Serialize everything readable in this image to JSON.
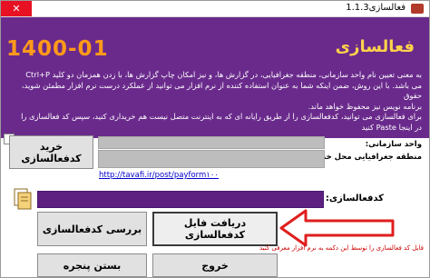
{
  "window": {
    "title": "فعالسازی1.1.3",
    "close_glyph": "✕"
  },
  "banner": {
    "date": "1400-01",
    "heading": "فعالسازی",
    "paragraph": [
      "به معنی تعیین نام واحد سازمانی، منطقه جغرافیایی، در گزارش ها، و نیز امکان چاپ گزارش ها، با زدن همزمان دو کلید Ctrl+P",
      "می باشد. با این روش، ضمن اینکه شما به عنوان استفاده کننده از نرم افزار می توانید از عملکرد درست نرم افزار مطمئن شوید، حقوق",
      "برنامه نویس نیز محفوظ خواهد ماند.",
      "برای فعالسازی می توانید، کدفعالسازی را از طریق رایانه ای که به اینترنت متصل نیست هم خریداری کنید، سپس کد فعالسازی را",
      "در اینجا Paste کنید"
    ]
  },
  "form": {
    "org_unit_label": "واحد سازمانی:",
    "region_label": "منطقه جغرافیایی محل خدمت:",
    "buy_code_button": "خرید کدفعالسازی",
    "link": "http://tavafi.ir/post/payform١٠٠",
    "code_label": "کدفعالسازی:",
    "download_file_button": "دریافت فایل کدفعالسازی",
    "check_code_button": "بررسی کدفعالسازی",
    "exit_button": "خروج",
    "close_window_button": "بستن پنجره",
    "note": "فایل کد فعالسازی را توسط این دکمه به نرم افزار معرفی کنید"
  },
  "colors": {
    "banner": "#6a2a8c",
    "date": "#ff9a1a",
    "heading": "#ffd24a",
    "arrow": "#e01e1e",
    "code_bar": "#5d2080"
  },
  "icons": {
    "app": "app-icon",
    "document": "document-icon",
    "arrow": "red-arrow-icon"
  }
}
